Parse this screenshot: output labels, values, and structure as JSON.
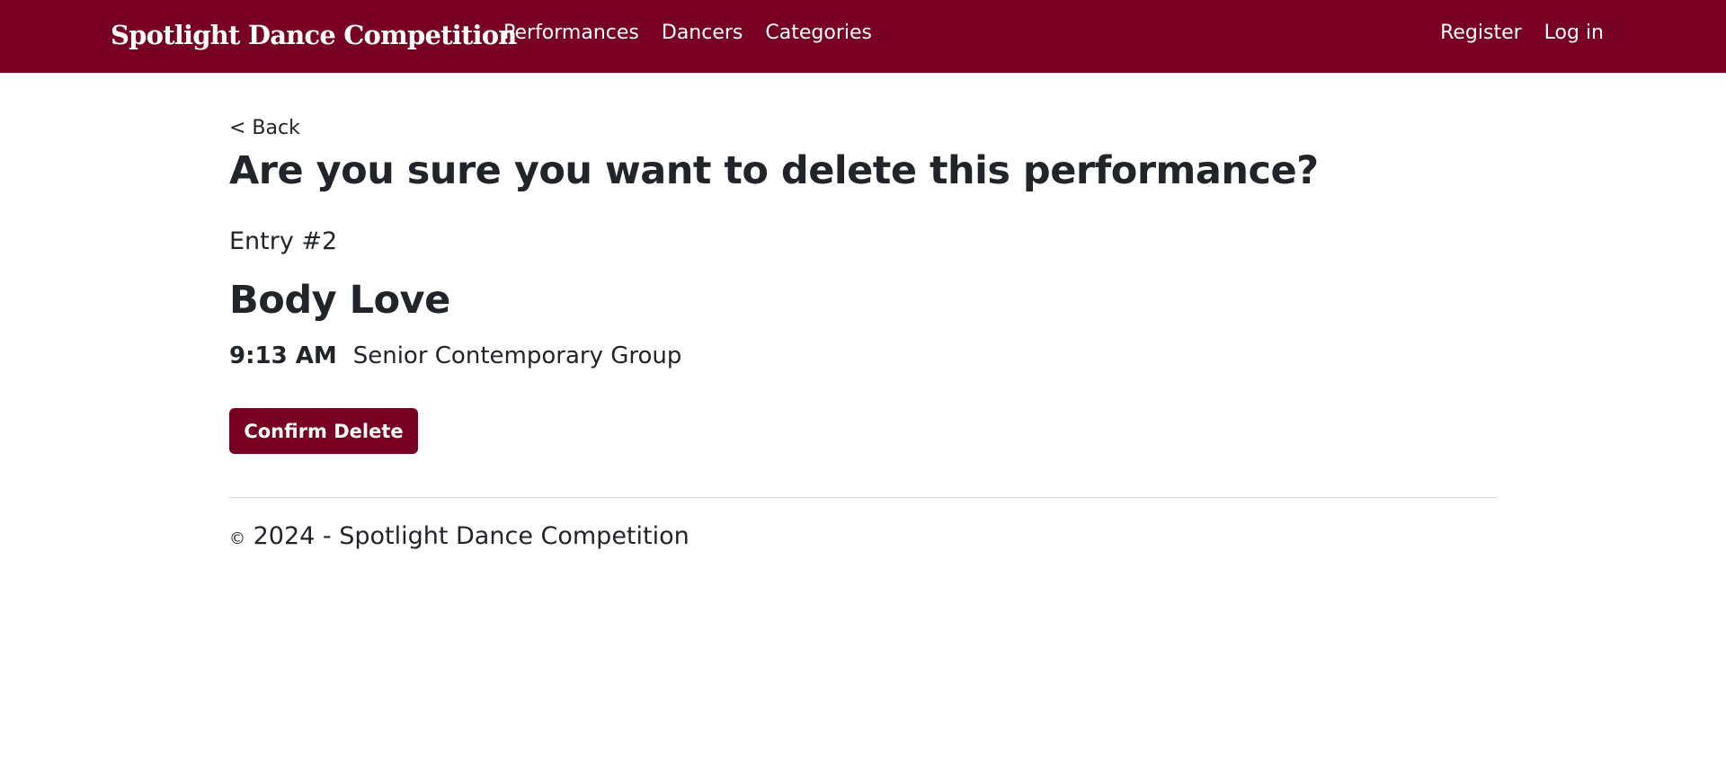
{
  "navbar": {
    "brand": "Spotlight Dance Competition",
    "links": [
      "Performances",
      "Dancers",
      "Categories"
    ],
    "register_label": "Register",
    "login_label": "Log in"
  },
  "page": {
    "back_label": "< Back",
    "title": "Are you sure you want to delete this performance?",
    "entry_number": "Entry #2",
    "performance_title": "Body Love",
    "time": "9:13 AM",
    "category": "Senior Contemporary Group",
    "confirm_label": "Confirm Delete"
  },
  "footer": {
    "copyright_symbol": "©",
    "text": "2024 - Spotlight Dance Competition"
  },
  "colors": {
    "brand": "#780022",
    "text": "#212529"
  }
}
